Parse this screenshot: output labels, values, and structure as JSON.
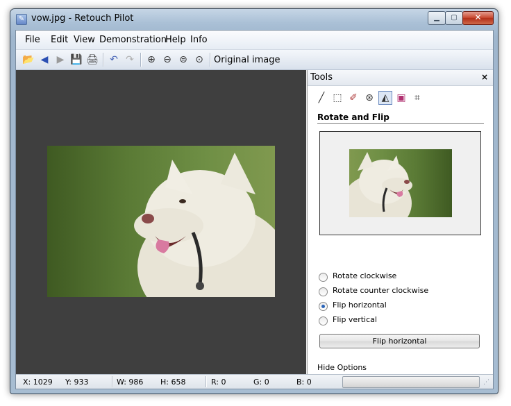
{
  "window": {
    "title": "vow.jpg - Retouch Pilot",
    "min_icon": "minimize-icon",
    "max_icon": "maximize-icon",
    "close_icon": "close-icon"
  },
  "menu": [
    "File",
    "Edit",
    "View",
    "Demonstration",
    "Help",
    "Info"
  ],
  "toolbar": {
    "buttons": [
      "open-folder-icon",
      "back-arrow-icon",
      "forward-arrow-icon",
      "save-icon",
      "print-icon",
      "undo-icon",
      "redo-icon",
      "zoom-in-icon",
      "zoom-out-icon",
      "zoom-fit-icon",
      "zoom-actual-icon"
    ],
    "original_label": "Original image"
  },
  "tools_panel": {
    "title": "Tools",
    "tool_icons": [
      "brush-icon",
      "lasso-icon",
      "eraser-icon",
      "healing-icon",
      "rotate-flip-icon",
      "color-adjust-icon",
      "crop-icon"
    ],
    "active_tool": "rotate-flip-icon",
    "section_title": "Rotate and Flip",
    "options": [
      {
        "label": "Rotate clockwise",
        "checked": false
      },
      {
        "label": "Rotate counter clockwise",
        "checked": false
      },
      {
        "label": "Flip horizontal",
        "checked": true
      },
      {
        "label": "Flip vertical",
        "checked": false
      }
    ],
    "action_button": "Flip horizontal",
    "hide_options": "Hide Options"
  },
  "status": {
    "x": "X: 1029",
    "y": "Y: 933",
    "w": "W: 986",
    "h": "H: 658",
    "r": "R: 0",
    "g": "G: 0",
    "b": "B: 0"
  },
  "colors": {
    "canvas_bg": "#3f3f3f",
    "accent": "#2a64b8"
  }
}
